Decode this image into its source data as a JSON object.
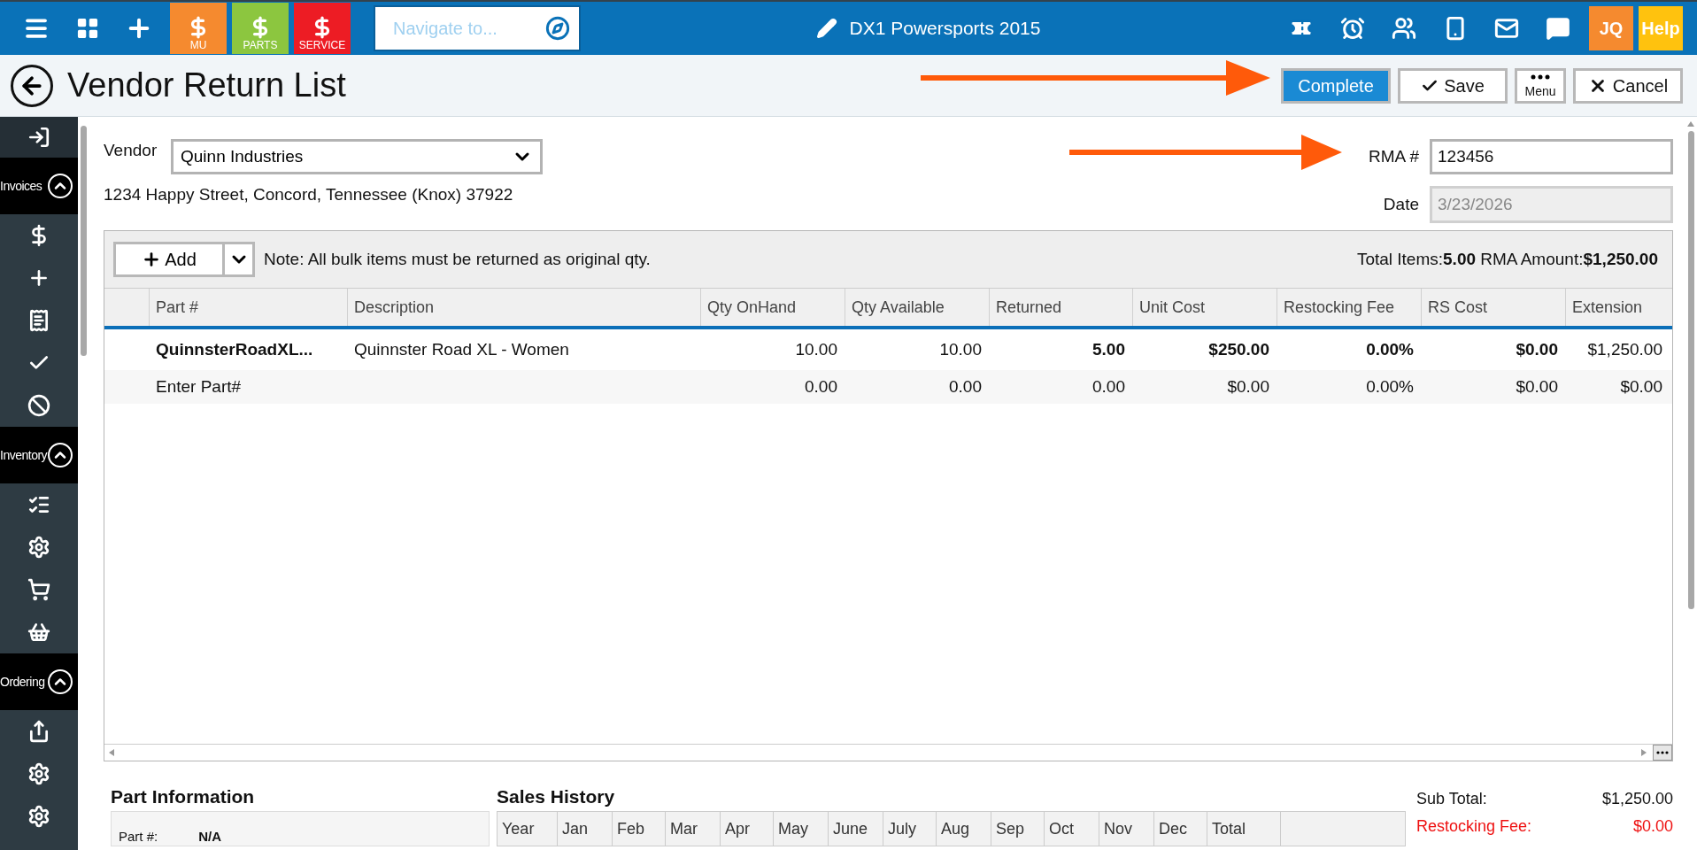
{
  "top_bar": {
    "tiles": [
      {
        "label": "MU",
        "color": "#f58a2f"
      },
      {
        "label": "PARTS",
        "color": "#8cc63f"
      },
      {
        "label": "SERVICE",
        "color": "#ed1c24"
      }
    ],
    "search": {
      "placeholder": "Navigate to..."
    },
    "title": "DX1 Powersports 2015",
    "user": "JQ",
    "help": "Help"
  },
  "page": {
    "title": "Vendor Return List",
    "buttons": [
      {
        "label": "Complete",
        "kind": "primary"
      },
      {
        "label": "Save",
        "kind": "save"
      },
      {
        "label": "Menu",
        "kind": "menu"
      },
      {
        "label": "Cancel",
        "kind": "cancel"
      }
    ]
  },
  "sidebar": {
    "top_icon": {
      "kind": "exit"
    },
    "sections": [
      {
        "label": "Invoices",
        "expanded": true,
        "icons": [
          {
            "kind": "dollar"
          },
          {
            "kind": "add"
          },
          {
            "kind": "refund"
          },
          {
            "kind": "check"
          },
          {
            "kind": "void"
          }
        ]
      },
      {
        "label": "Inventory",
        "expanded": true,
        "icons": [
          {
            "kind": "list"
          },
          {
            "kind": "gear"
          },
          {
            "kind": "cart"
          },
          {
            "kind": "basket"
          }
        ]
      },
      {
        "label": "Ordering",
        "expanded": true,
        "icons": [
          {
            "kind": "share"
          },
          {
            "kind": "gear"
          },
          {
            "kind": "gear"
          }
        ]
      }
    ]
  },
  "form": {
    "vendor_label": "Vendor",
    "vendor": "Quinn Industries",
    "address": "1234 Happy Street, Concord, Tennessee (Knox) 37922",
    "rma_label": "RMA #",
    "rma": "123456",
    "date_label": "Date",
    "date": "3/23/2026"
  },
  "grid": {
    "add_label": "Add",
    "note": "Note: All bulk items must be returned as original qty.",
    "totals": "Total Items:**5.00** RMA Amount:**$1,250.00**",
    "columns": [
      {
        "label": "Part #",
        "kind": "text",
        "editable": true
      },
      {
        "label": "Description",
        "kind": "text",
        "editable": false
      },
      {
        "label": "Qty OnHand",
        "kind": "number",
        "editable": false
      },
      {
        "label": "Qty Available",
        "kind": "number",
        "editable": false
      },
      {
        "label": "Returned",
        "kind": "number",
        "editable": true
      },
      {
        "label": "Unit Cost",
        "kind": "number",
        "editable": true
      },
      {
        "label": "Restocking Fee",
        "kind": "number",
        "editable": true
      },
      {
        "label": "RS Cost",
        "kind": "number",
        "editable": true
      },
      {
        "label": "Extension",
        "kind": "number",
        "editable": false
      }
    ],
    "rows": [
      {
        "kind": "item",
        "cells": [
          "QuinnsterRoadXL...",
          "Quinnster Road XL - Women",
          "10.00",
          "10.00",
          "5.00",
          "$250.00",
          "0.00%",
          "$0.00",
          "$1,250.00"
        ]
      },
      {
        "kind": "new",
        "cells": [
          "Enter Part#",
          "",
          "0.00",
          "0.00",
          "0.00",
          "$0.00",
          "0.00%",
          "$0.00",
          "$0.00"
        ]
      }
    ]
  },
  "part_information": {
    "title": "Part Information",
    "label": "Part #:",
    "value": "N/A"
  },
  "sales_history": {
    "title": "Sales History",
    "columns": [
      "Year",
      "Jan",
      "Feb",
      "Mar",
      "Apr",
      "May",
      "June",
      "July",
      "Aug",
      "Sep",
      "Oct",
      "Nov",
      "Dec",
      "Total"
    ]
  },
  "summary": [
    {
      "label": "Sub Total:",
      "value": "$1,250.00",
      "highlight": false
    },
    {
      "label": "Restocking Fee:",
      "value": "$0.00",
      "highlight": true
    }
  ]
}
